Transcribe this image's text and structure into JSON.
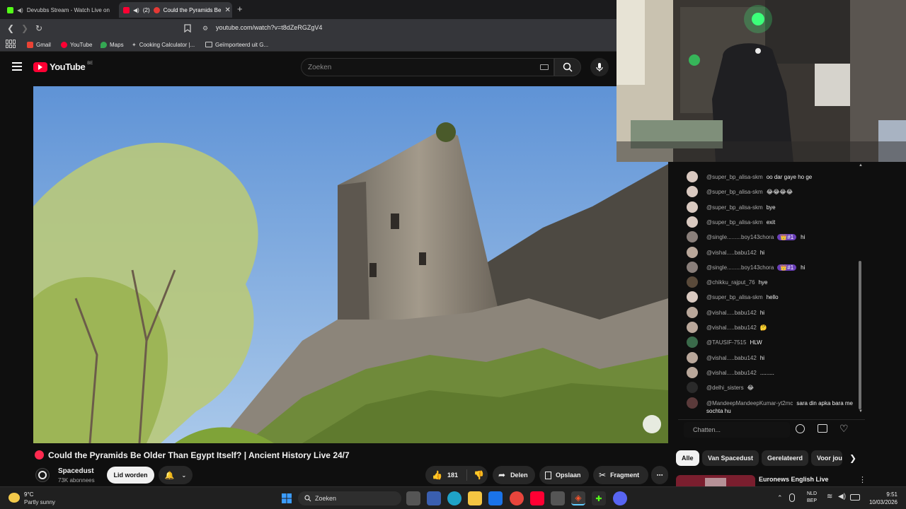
{
  "browser": {
    "tabs": [
      {
        "label": "Devubbs Stream - Watch Live on"
      },
      {
        "label": "Could the Pyramids Be"
      }
    ],
    "tab_count_badge": "(2)",
    "address": "youtube.com/watch?v=t8dZeRGZgV4",
    "bookmarks": [
      {
        "label": "Gmail"
      },
      {
        "label": "YouTube"
      },
      {
        "label": "Maps"
      },
      {
        "label": "Cooking Calculator |..."
      },
      {
        "label": "Geïmporteerd uit G..."
      }
    ]
  },
  "youtube": {
    "logo_text": "YouTube",
    "region": "BE",
    "search_placeholder": "Zoeken"
  },
  "video": {
    "title": "Could the Pyramids Be Older Than Egypt Itself? | Ancient History Live 24/7",
    "channel": "Spacedust",
    "subscribers": "73K abonnees",
    "join_label": "Lid worden",
    "likes": "181",
    "share_label": "Delen",
    "save_label": "Opslaan",
    "clip_label": "Fragment"
  },
  "chat": {
    "messages": [
      {
        "name": "@super_bp_alisa-skm",
        "text": "oo dar gaye ho ge",
        "color": "#d9c9c0"
      },
      {
        "name": "@super_bp_alisa-skm",
        "text": "😂😂😂😂",
        "color": "#d9c9c0"
      },
      {
        "name": "@super_bp_alisa-skm",
        "text": "bye",
        "color": "#d9c9c0"
      },
      {
        "name": "@super_bp_alisa-skm",
        "text": "exit",
        "color": "#d9c9c0"
      },
      {
        "name": "@single.........boy143chora",
        "text": "hi",
        "badge": "👑#1",
        "color": "#8a7f7a"
      },
      {
        "name": "@vishal.....babu142",
        "text": "hi",
        "color": "#b9a79a"
      },
      {
        "name": "@single.........boy143chora",
        "text": "hi",
        "badge": "👑#1",
        "color": "#8a7f7a"
      },
      {
        "name": "@chikku_rajput_76",
        "text": "hye",
        "color": "#5a4a3a"
      },
      {
        "name": "@super_bp_alisa-skm",
        "text": "hello",
        "color": "#d9c9c0"
      },
      {
        "name": "@vishal.....babu142",
        "text": "hi",
        "color": "#b9a79a"
      },
      {
        "name": "@vishal.....babu142",
        "text": "🤔",
        "color": "#b9a79a"
      },
      {
        "name": "@TAUSIF-7515",
        "text": "HLW",
        "color": "#3a6a4a"
      },
      {
        "name": "@vishal.....babu142",
        "text": "hi",
        "color": "#b9a79a"
      },
      {
        "name": "@vishal.....babu142",
        "text": ".........",
        "color": "#b9a79a"
      },
      {
        "name": "@delhi_sisters",
        "text": "😂",
        "color": "#2a2a2a"
      },
      {
        "name": "@MandeepMandeepKumar-yt2mc",
        "text": "sara din apka bara me sochta hu",
        "color": "#5a3a3a"
      }
    ],
    "input_placeholder": "Chatten..."
  },
  "chips": [
    {
      "label": "Alle"
    },
    {
      "label": "Van Spacedust"
    },
    {
      "label": "Gerelateerd"
    },
    {
      "label": "Voor jou"
    }
  ],
  "recommendation": {
    "title": "Euronews English Live"
  },
  "taskbar": {
    "weather_temp": "9°C",
    "weather_desc": "Partly sunny",
    "search_placeholder": "Zoeken",
    "lang_top": "NLD",
    "lang_bottom": "BEP",
    "time": "9:51",
    "date": "10/03/2026"
  },
  "colors": {
    "accent_red": "#ff0033",
    "badge_purple": "#6a3fb8"
  }
}
